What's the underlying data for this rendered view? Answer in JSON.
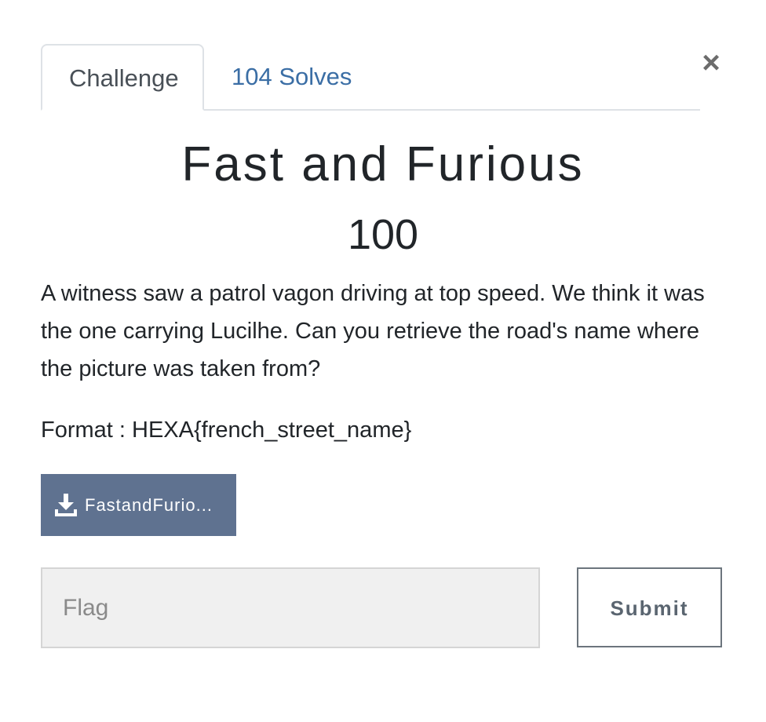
{
  "tabs": [
    {
      "label": "Challenge",
      "active": true
    },
    {
      "label": "104 Solves",
      "active": false
    }
  ],
  "close_symbol": "×",
  "challenge": {
    "title": "Fast and Furious",
    "points": "100",
    "description": "A witness saw a patrol vagon driving at top speed. We think it was the one carrying Lucilhe. Can you retrieve the road's name where the picture was taken from?",
    "format": "Format : HEXA{french_street_name}"
  },
  "file": {
    "label": "FastandFurio...",
    "icon": "download-icon"
  },
  "flag_input": {
    "placeholder": "Flag",
    "value": ""
  },
  "submit_label": "Submit",
  "colors": {
    "tab_link": "#3b6ea5",
    "file_button": "#5f7290",
    "input_bg": "#f0f0f0"
  }
}
